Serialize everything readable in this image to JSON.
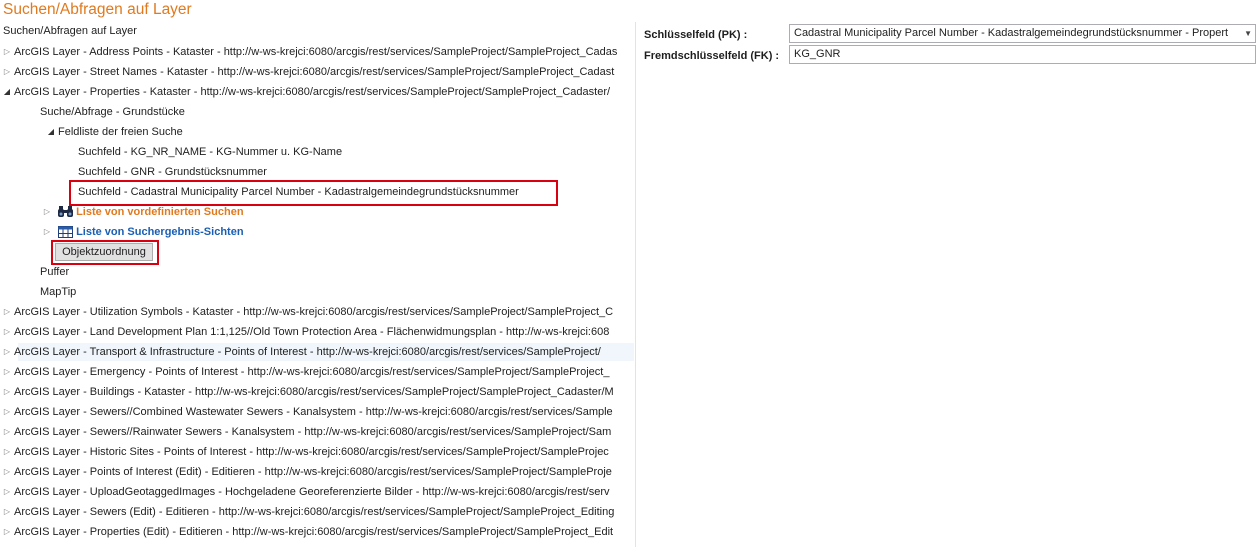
{
  "header": {
    "title": "Suchen/Abfragen auf Layer",
    "tree_root_label": "Suchen/Abfragen auf Layer"
  },
  "tree": {
    "layers_top": [
      {
        "label": "ArcGIS Layer - Address Points - Kataster - http://w-ws-krejci:6080/arcgis/rest/services/SampleProject/SampleProject_Cadas",
        "expanded": false
      },
      {
        "label": "ArcGIS Layer - Street Names - Kataster - http://w-ws-krejci:6080/arcgis/rest/services/SampleProject/SampleProject_Cadast",
        "expanded": false
      },
      {
        "label": "ArcGIS Layer - Properties - Kataster - http://w-ws-krejci:6080/arcgis/rest/services/SampleProject/SampleProject_Cadaster/",
        "expanded": true
      }
    ],
    "properties_children": {
      "search_query": "Suche/Abfrage - Grundstücke",
      "field_list": "Feldliste der freien Suche",
      "fields": [
        "Suchfeld - KG_NR_NAME - KG-Nummer u. KG-Name",
        "Suchfeld - GNR - Grundstücksnummer",
        "Suchfeld - Cadastral Municipality Parcel Number - Kadastralgemeindegrundstücksnummer"
      ],
      "predefined_searches": "Liste von vordefinierten Suchen",
      "result_views": "Liste von Suchergebnis-Sichten",
      "object_assignment_button": "Objektzuordnung",
      "buffer": "Puffer",
      "maptip": "MapTip"
    },
    "layers_bottom": [
      "ArcGIS Layer - Utilization Symbols - Kataster - http://w-ws-krejci:6080/arcgis/rest/services/SampleProject/SampleProject_C",
      "ArcGIS Layer - Land Development Plan 1:1,125//Old Town Protection Area - Flächenwidmungsplan - http://w-ws-krejci:608",
      "ArcGIS Layer - Transport & Infrastructure - Points of Interest - http://w-ws-krejci:6080/arcgis/rest/services/SampleProject/",
      "ArcGIS Layer - Emergency - Points of Interest - http://w-ws-krejci:6080/arcgis/rest/services/SampleProject/SampleProject_",
      "ArcGIS Layer - Buildings - Kataster - http://w-ws-krejci:6080/arcgis/rest/services/SampleProject/SampleProject_Cadaster/M",
      "ArcGIS Layer - Sewers//Combined Wastewater Sewers - Kanalsystem - http://w-ws-krejci:6080/arcgis/rest/services/Sample",
      "ArcGIS Layer - Sewers//Rainwater Sewers - Kanalsystem - http://w-ws-krejci:6080/arcgis/rest/services/SampleProject/Sam",
      "ArcGIS Layer - Historic Sites - Points of Interest - http://w-ws-krejci:6080/arcgis/rest/services/SampleProject/SampleProjec",
      "ArcGIS Layer - Points of Interest (Edit) - Editieren - http://w-ws-krejci:6080/arcgis/rest/services/SampleProject/SampleProje",
      "ArcGIS Layer - UploadGeotaggedImages - Hochgeladene Georeferenzierte Bilder - http://w-ws-krejci:6080/arcgis/rest/serv",
      "ArcGIS Layer - Sewers (Edit) - Editieren - http://w-ws-krejci:6080/arcgis/rest/services/SampleProject/SampleProject_Editing",
      "ArcGIS Layer - Properties (Edit) - Editieren - http://w-ws-krejci:6080/arcgis/rest/services/SampleProject/SampleProject_Edit"
    ]
  },
  "details": {
    "pk_label": "Schlüsselfeld (PK) :",
    "pk_value": "Cadastral Municipality Parcel Number - Kadastralgemeindegrundstücksnummer - Propert",
    "fk_label": "Fremdschlüsselfeld (FK) :",
    "fk_value": "KG_GNR"
  },
  "colors": {
    "title": "#e07a1f",
    "predefined_link": "#e07a1f",
    "result_views_link": "#1a5fb4",
    "highlight_border": "#d9000f"
  },
  "icons": {
    "collapsed": "triangle-right",
    "expanded": "triangle-down-right",
    "predefined_searches": "binoculars-icon",
    "result_views": "table-view-icon",
    "pk_dropdown": "chevron-down-icon"
  }
}
